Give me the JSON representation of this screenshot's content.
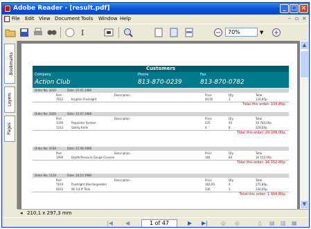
{
  "window": {
    "title": "Adobe Reader - [result.pdf]"
  },
  "menu": [
    "File",
    "Edit",
    "View",
    "Document",
    "Tools",
    "Window",
    "Help"
  ],
  "toolbar": {
    "zoom": "70%"
  },
  "left_tabs": [
    "Bookmarks",
    "Layers",
    "Pages"
  ],
  "report": {
    "title": "Customers",
    "customer": {
      "company_label": "Company",
      "company": "Action Club",
      "phone_label": "Phone",
      "phone": "813-870-0239",
      "fax_label": "Fax",
      "fax": "813-870-0782"
    },
    "col_labels": {
      "part": "Part",
      "desc": "Description",
      "price": "Price",
      "qty": "Qty",
      "total": "Total"
    },
    "orders": [
      {
        "no": "Order No: 1010",
        "date": "Date: 25.05.1988",
        "total": "Total this order: 134,85p.",
        "items": [
          {
            "part": "7612",
            "desc": "Krypton Flashlight",
            "price": "44,95",
            "qty": "3",
            "total": "134,85p."
          }
        ]
      },
      {
        "no": "Order No: 1029",
        "date": "Date: 15.07.1988",
        "total": "Total this order: 20 108,00p.",
        "items": [
          {
            "part": "1330",
            "desc": "Regulator System",
            "price": "435",
            "qty": "40",
            "total": "19 760,00p."
          },
          {
            "part": "1313",
            "desc": "Safety Knife",
            "price": "4",
            "qty": "8",
            "total": "328,00p."
          }
        ]
      },
      {
        "no": "Order No: 1038",
        "date": "Date: 25.08.1988",
        "total": "Total this order: 16 152,00p.",
        "items": [
          {
            "part": "1990",
            "desc": "Depth/Pressure Gauge Console",
            "price": "184",
            "qty": "84",
            "total": "16 152,00p."
          }
        ]
      },
      {
        "no": "Order No: 1129",
        "date": "Date: 10.10.1989",
        "total": "Total this order: 1 004,80p.",
        "items": [
          {
            "part": "7619",
            "desc": "Flashlight (Rechargeable)",
            "price": "183,95",
            "qty": "4",
            "total": "275,80p."
          },
          {
            "part": "6615",
            "desc": "96 1/4 ft Tank",
            "price": "336",
            "qty": "1",
            "total": "336,00p."
          }
        ]
      }
    ]
  },
  "status": {
    "page_size": "210,1 x 297,3 mm"
  },
  "nav": {
    "page": "1 of 47"
  }
}
